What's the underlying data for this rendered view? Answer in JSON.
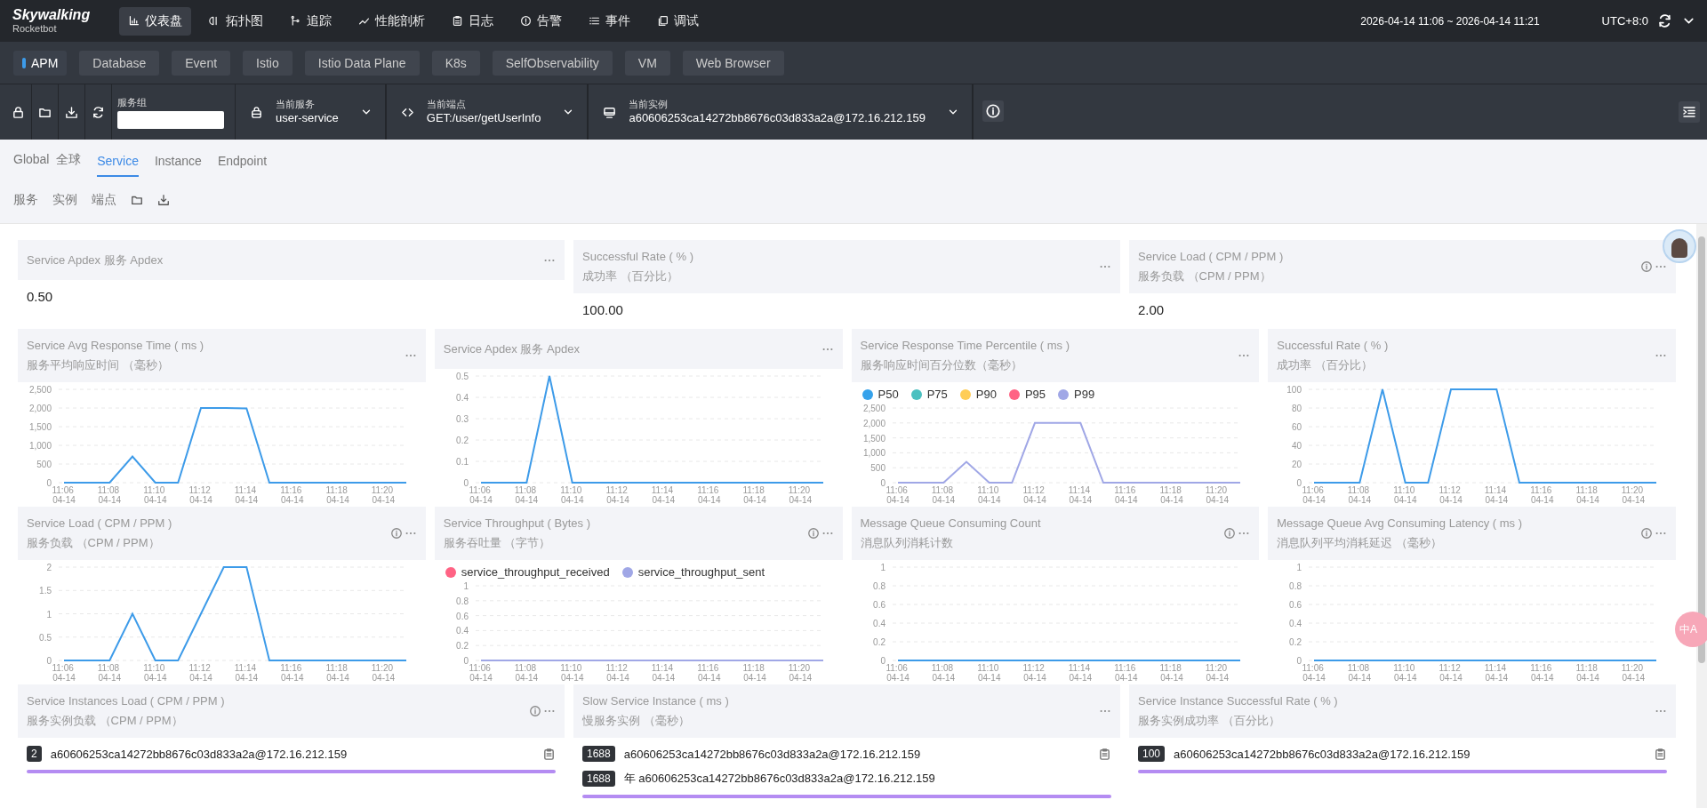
{
  "header": {
    "logo": "Skywalking",
    "logo_sub": "Rocketbot",
    "nav": [
      {
        "label": "仪表盘",
        "selected": true
      },
      {
        "label": "拓扑图",
        "selected": false
      },
      {
        "label": "追踪",
        "selected": false
      },
      {
        "label": "性能剖析",
        "selected": false
      },
      {
        "label": "日志",
        "selected": false
      },
      {
        "label": "告警",
        "selected": false
      },
      {
        "label": "事件",
        "selected": false
      },
      {
        "label": "调试",
        "selected": false
      }
    ],
    "time_range": "2026-04-14 11:06 ~ 2026-04-14 11:21",
    "timezone": "UTC+8:0"
  },
  "layers": [
    {
      "label": "APM",
      "selected": true
    },
    {
      "label": "Database",
      "selected": false
    },
    {
      "label": "Event",
      "selected": false
    },
    {
      "label": "Istio",
      "selected": false
    },
    {
      "label": "Istio Data Plane",
      "selected": false
    },
    {
      "label": "K8s",
      "selected": false
    },
    {
      "label": "SelfObservability",
      "selected": false
    },
    {
      "label": "VM",
      "selected": false
    },
    {
      "label": "Web Browser",
      "selected": false
    }
  ],
  "toolbar": {
    "service_group": {
      "label": "服务组"
    },
    "selectors": [
      {
        "label": "当前服务",
        "value": "user-service"
      },
      {
        "label": "当前端点",
        "value": "GET:/user/getUserInfo"
      },
      {
        "label": "当前实例",
        "value": "a60606253ca14272bb8676c03d833a2a@172.16.212.159"
      }
    ]
  },
  "tabs": [
    {
      "label": "Global  全球",
      "selected": false
    },
    {
      "label": "Service",
      "selected": true
    },
    {
      "label": "Instance",
      "selected": false
    },
    {
      "label": "Endpoint",
      "selected": false
    }
  ],
  "sub_tabs": [
    "服务",
    "实例",
    "端点"
  ],
  "rows": [
    [
      {
        "kind": "card",
        "title": "Service Apdex 服务 Apdex",
        "info": false,
        "value": "0.50"
      },
      {
        "kind": "card",
        "title": "Successful Rate ( % )",
        "subtitle": "成功率 （百分比）",
        "info": false,
        "value": "100.00"
      },
      {
        "kind": "card",
        "title": "Service Load ( CPM / PPM )",
        "subtitle": "服务负载 （CPM / PPM）",
        "info": true,
        "value": "2.00"
      }
    ],
    [
      {
        "kind": "chart",
        "title": "Service Avg Response Time ( ms )",
        "subtitle": "服务平均响应时间 （毫秒）",
        "info": false,
        "chart_data": {
          "type": "line",
          "categories": [
            "11:06 04-14",
            null,
            "11:08 04-14",
            null,
            "11:10 04-14",
            null,
            "11:12 04-14",
            null,
            "11:14 04-14",
            null,
            "11:16 04-14",
            null,
            "11:18 04-14",
            null,
            "11:20 04-14",
            null
          ],
          "grid": true,
          "ylim": [
            0,
            2500
          ],
          "yticks": [
            0,
            {
              "value": 500,
              "label": "500"
            },
            {
              "value": 1000,
              "label": "1,000"
            },
            {
              "value": 1500,
              "label": "1,500"
            },
            {
              "value": 2000,
              "label": "2,000"
            },
            {
              "value": 2500,
              "label": "2,500"
            }
          ],
          "series": [
            {
              "color": "#3d9be9",
              "values": [
                0,
                0,
                0,
                700,
                0,
                0,
                2000,
                2000,
                1990,
                0,
                0,
                0,
                0,
                0,
                0,
                0
              ]
            }
          ]
        }
      },
      {
        "kind": "chart",
        "title": "Service Apdex 服务 Apdex",
        "info": false,
        "chart_data": {
          "type": "line",
          "categories": [
            "11:06 04-14",
            null,
            "11:08 04-14",
            null,
            "11:10 04-14",
            null,
            "11:12 04-14",
            null,
            "11:14 04-14",
            null,
            "11:16 04-14",
            null,
            "11:18 04-14",
            null,
            "11:20 04-14",
            null
          ],
          "grid": true,
          "ylim": [
            0,
            0.5
          ],
          "yticks": [
            0,
            0.1,
            0.2,
            0.3,
            0.4,
            0.5
          ],
          "series": [
            {
              "color": "#3d9be9",
              "values": [
                0,
                0,
                0,
                0.5,
                0,
                0,
                0,
                0,
                0,
                0,
                0,
                0,
                0,
                0,
                0,
                0
              ]
            }
          ]
        }
      },
      {
        "kind": "chart",
        "title": "Service Response Time Percentile ( ms )",
        "subtitle": "服务响应时间百分位数（毫秒）",
        "info": false,
        "chart_data": {
          "type": "line",
          "categories": [
            "11:06 04-14",
            null,
            "11:08 04-14",
            null,
            "11:10 04-14",
            null,
            "11:12 04-14",
            null,
            "11:14 04-14",
            null,
            "11:16 04-14",
            null,
            "11:18 04-14",
            null,
            "11:20 04-14",
            null
          ],
          "grid": true,
          "ylim": [
            0,
            2500
          ],
          "yticks": [
            0,
            {
              "value": 500,
              "label": "500"
            },
            {
              "value": 1000,
              "label": "1,000"
            },
            {
              "value": 1500,
              "label": "1,500"
            },
            {
              "value": 2000,
              "label": "2,000"
            },
            {
              "value": 2500,
              "label": "2,500"
            }
          ],
          "series": [
            {
              "name": "P50",
              "color": "#36a2eb",
              "values": [
                null,
                null,
                null,
                null,
                null,
                null,
                null,
                null,
                null,
                null,
                null,
                null,
                null,
                null,
                null,
                null
              ]
            },
            {
              "name": "P75",
              "color": "#4bc0c0",
              "values": [
                null,
                null,
                null,
                null,
                null,
                null,
                null,
                null,
                null,
                null,
                null,
                null,
                null,
                null,
                null,
                null
              ]
            },
            {
              "name": "P90",
              "color": "#ffcd56",
              "values": [
                null,
                null,
                null,
                null,
                null,
                null,
                null,
                null,
                null,
                null,
                null,
                null,
                null,
                null,
                null,
                null
              ]
            },
            {
              "name": "P95",
              "color": "#ff6384",
              "values": [
                null,
                null,
                null,
                null,
                null,
                null,
                null,
                null,
                null,
                null,
                null,
                null,
                null,
                null,
                null,
                null
              ]
            },
            {
              "name": "P99",
              "color": "#a0a7e6",
              "values": [
                0,
                0,
                0,
                700,
                0,
                0,
                2000,
                2000,
                2000,
                0,
                0,
                0,
                0,
                0,
                0,
                0
              ]
            }
          ]
        }
      },
      {
        "kind": "chart",
        "title": "Successful Rate ( % )",
        "subtitle": "成功率 （百分比）",
        "info": false,
        "chart_data": {
          "type": "line",
          "categories": [
            "11:06 04-14",
            null,
            "11:08 04-14",
            null,
            "11:10 04-14",
            null,
            "11:12 04-14",
            null,
            "11:14 04-14",
            null,
            "11:16 04-14",
            null,
            "11:18 04-14",
            null,
            "11:20 04-14",
            null
          ],
          "grid": true,
          "ylim": [
            0,
            100
          ],
          "yticks": [
            0,
            20,
            40,
            60,
            80,
            100
          ],
          "series": [
            {
              "color": "#3d9be9",
              "values": [
                0,
                0,
                0,
                100,
                0,
                0,
                100,
                100,
                100,
                0,
                0,
                0,
                0,
                0,
                0,
                0
              ]
            }
          ]
        }
      }
    ],
    [
      {
        "kind": "chart",
        "title": "Service Load ( CPM / PPM )",
        "subtitle": "服务负载 （CPM / PPM）",
        "info": true,
        "chart_data": {
          "type": "line",
          "categories": [
            "11:06 04-14",
            null,
            "11:08 04-14",
            null,
            "11:10 04-14",
            null,
            "11:12 04-14",
            null,
            "11:14 04-14",
            null,
            "11:16 04-14",
            null,
            "11:18 04-14",
            null,
            "11:20 04-14",
            null
          ],
          "grid": true,
          "ylim": [
            0,
            2
          ],
          "yticks": [
            0,
            0.5,
            1,
            1.5,
            2
          ],
          "series": [
            {
              "color": "#3d9be9",
              "values": [
                0,
                0,
                0,
                1,
                0,
                0,
                1,
                2,
                2,
                0,
                0,
                0,
                0,
                0,
                0,
                0
              ]
            }
          ]
        }
      },
      {
        "kind": "chart",
        "title": "Service Throughput ( Bytes )",
        "subtitle": "服务吞吐量 （字节）",
        "info": true,
        "chart_data": {
          "type": "line",
          "categories": [
            "11:06 04-14",
            null,
            "11:08 04-14",
            null,
            "11:10 04-14",
            null,
            "11:12 04-14",
            null,
            "11:14 04-14",
            null,
            "11:16 04-14",
            null,
            "11:18 04-14",
            null,
            "11:20 04-14",
            null
          ],
          "grid": true,
          "ylim": [
            0,
            1
          ],
          "yticks": [
            0,
            0.2,
            0.4,
            0.6,
            0.8,
            1
          ],
          "series": [
            {
              "name": "service_throughput_received",
              "color": "#ff6384",
              "values": [
                null,
                null,
                null,
                null,
                null,
                null,
                null,
                null,
                null,
                null,
                null,
                null,
                null,
                null,
                null,
                null
              ]
            },
            {
              "name": "service_throughput_sent",
              "color": "#a0a7e6",
              "values": [
                0,
                0,
                0,
                0,
                0,
                0,
                0,
                0,
                0,
                0,
                0,
                0,
                0,
                0,
                0,
                0
              ]
            }
          ]
        }
      },
      {
        "kind": "chart",
        "title": "Message Queue Consuming Count",
        "subtitle": "消息队列消耗计数",
        "info": true,
        "chart_data": {
          "type": "line",
          "categories": [
            "11:06 04-14",
            null,
            "11:08 04-14",
            null,
            "11:10 04-14",
            null,
            "11:12 04-14",
            null,
            "11:14 04-14",
            null,
            "11:16 04-14",
            null,
            "11:18 04-14",
            null,
            "11:20 04-14",
            null
          ],
          "grid": true,
          "ylim": [
            0,
            1
          ],
          "yticks": [
            0,
            0.2,
            0.4,
            0.6,
            0.8,
            1
          ],
          "series": [
            {
              "color": "#3d9be9",
              "values": [
                0,
                0,
                0,
                0,
                0,
                0,
                0,
                0,
                0,
                0,
                0,
                0,
                0,
                0,
                0,
                0
              ]
            }
          ]
        }
      },
      {
        "kind": "chart",
        "title": "Message Queue Avg Consuming Latency ( ms )",
        "subtitle": "消息队列平均消耗延迟 （毫秒）",
        "info": true,
        "chart_data": {
          "type": "line",
          "categories": [
            "11:06 04-14",
            null,
            "11:08 04-14",
            null,
            "11:10 04-14",
            null,
            "11:12 04-14",
            null,
            "11:14 04-14",
            null,
            "11:16 04-14",
            null,
            "11:18 04-14",
            null,
            "11:20 04-14",
            null
          ],
          "grid": true,
          "ylim": [
            0,
            1
          ],
          "yticks": [
            0,
            0.2,
            0.4,
            0.6,
            0.8,
            1
          ],
          "series": [
            {
              "color": "#3d9be9",
              "values": [
                0,
                0,
                0,
                0,
                0,
                0,
                0,
                0,
                0,
                0,
                0,
                0,
                0,
                0,
                0,
                0
              ]
            }
          ]
        }
      }
    ],
    [
      {
        "kind": "list",
        "title": "Service Instances Load ( CPM / PPM )",
        "subtitle": "服务实例负载 （CPM / PPM）",
        "info": true,
        "items": [
          {
            "value": "2",
            "name": "a60606253ca14272bb8676c03d833a2a@172.16.212.159"
          }
        ]
      },
      {
        "kind": "list",
        "title": "Slow Service Instance ( ms )",
        "subtitle": "慢服务实例 （毫秒）",
        "info": false,
        "items": [
          {
            "value": "1688",
            "name": "a60606253ca14272bb8676c03d833a2a@172.16.212.159"
          },
          {
            "value": "1688",
            "name": "年 a60606253ca14272bb8676c03d833a2a@172.16.212.159"
          }
        ]
      },
      {
        "kind": "list",
        "title": "Service Instance Successful Rate ( % )",
        "subtitle": "服务实例成功率 （百分比）",
        "info": false,
        "items": [
          {
            "value": "100",
            "name": "a60606253ca14272bb8676c03d833a2a@172.16.212.159"
          }
        ]
      }
    ]
  ],
  "translate_button": "中A"
}
